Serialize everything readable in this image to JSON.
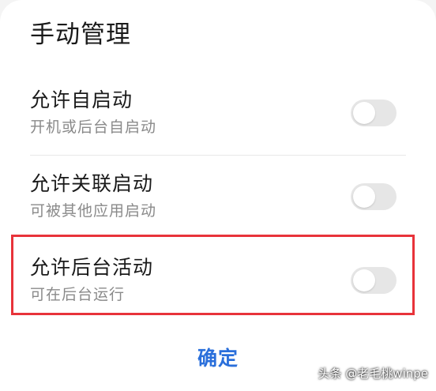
{
  "dialog": {
    "title": "手动管理",
    "rows": [
      {
        "label": "允许自启动",
        "sub": "开机或后台自启动",
        "enabled": false
      },
      {
        "label": "允许关联启动",
        "sub": "可被其他应用启动",
        "enabled": false
      },
      {
        "label": "允许后台活动",
        "sub": "可在后台运行",
        "enabled": false
      }
    ],
    "confirm_label": "确定"
  },
  "watermark": "头条 @老毛桃winpe",
  "colors": {
    "accent": "#2a6fdb",
    "highlight": "#e8333a",
    "toggle_off": "#e6e6e6"
  }
}
